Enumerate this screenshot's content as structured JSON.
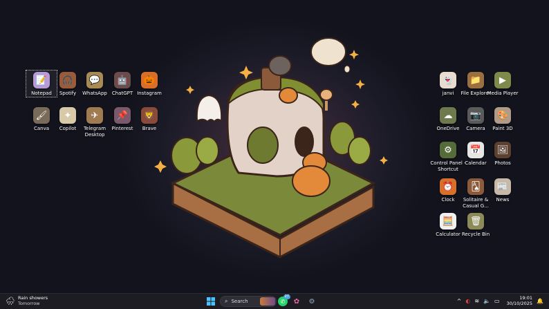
{
  "desktop_icons_left": [
    {
      "label": "Notepad",
      "icon": "notepad-icon",
      "glyph": "📝",
      "cls": "g-note"
    },
    {
      "label": "Spotify",
      "icon": "spotify-icon",
      "glyph": "🎧",
      "cls": "g-spot"
    },
    {
      "label": "WhatsApp",
      "icon": "whatsapp-icon",
      "glyph": "💬",
      "cls": "g-wa"
    },
    {
      "label": "ChatGPT",
      "icon": "chatgpt-icon",
      "glyph": "🤖",
      "cls": "g-gpt"
    },
    {
      "label": "Instagram",
      "icon": "instagram-icon",
      "glyph": "🎃",
      "cls": "g-ig"
    },
    {
      "label": "Canva",
      "icon": "canva-icon",
      "glyph": "🖌",
      "cls": "g-canva"
    },
    {
      "label": "Copilot",
      "icon": "copilot-icon",
      "glyph": "✦",
      "cls": "g-cop"
    },
    {
      "label": "Telegram Desktop",
      "icon": "telegram-icon",
      "glyph": "✈",
      "cls": "g-tg"
    },
    {
      "label": "Pinterest",
      "icon": "pinterest-icon",
      "glyph": "📌",
      "cls": "g-pin"
    },
    {
      "label": "Brave",
      "icon": "brave-icon",
      "glyph": "🦁",
      "cls": "g-brave"
    }
  ],
  "desktop_icons_right": [
    {
      "label": "janvi",
      "icon": "user-folder-icon",
      "glyph": "👻",
      "cls": "g-janvi"
    },
    {
      "label": "File Explorer",
      "icon": "file-explorer-icon",
      "glyph": "📁",
      "cls": "g-fe"
    },
    {
      "label": "Media Player",
      "icon": "media-player-icon",
      "glyph": "▶",
      "cls": "g-mp"
    },
    {
      "label": "OneDrive",
      "icon": "onedrive-icon",
      "glyph": "☁",
      "cls": "g-od"
    },
    {
      "label": "Camera",
      "icon": "camera-icon",
      "glyph": "📷",
      "cls": "g-cam"
    },
    {
      "label": "Paint 3D",
      "icon": "paint-3d-icon",
      "glyph": "🎨",
      "cls": "g-p3d"
    },
    {
      "label": "Control Panel - Shortcut",
      "icon": "control-panel-icon",
      "glyph": "⚙",
      "cls": "g-cp"
    },
    {
      "label": "Calendar",
      "icon": "calendar-icon",
      "glyph": "📅",
      "cls": "g-cal"
    },
    {
      "label": "Photos",
      "icon": "photos-icon",
      "glyph": "🖼",
      "cls": "g-ph"
    },
    {
      "label": "Clock",
      "icon": "clock-icon",
      "glyph": "⏰",
      "cls": "g-clk"
    },
    {
      "label": "Solitaire & Casual G...",
      "icon": "solitaire-icon",
      "glyph": "🂡",
      "cls": "g-sol"
    },
    {
      "label": "News",
      "icon": "news-icon",
      "glyph": "📰",
      "cls": "g-news"
    },
    {
      "label": "Calculator",
      "icon": "calculator-icon",
      "glyph": "🧮",
      "cls": "g-calc"
    },
    {
      "label": "Recycle Bin",
      "icon": "recycle-bin-icon",
      "glyph": "🗑",
      "cls": "g-bin"
    }
  ],
  "taskbar": {
    "weather_title": "Rain showers",
    "weather_subtitle": "Tomorrow",
    "search_label": "Search",
    "whatsapp_badge": "27",
    "time": "19:01",
    "date": "30/10/2025"
  }
}
